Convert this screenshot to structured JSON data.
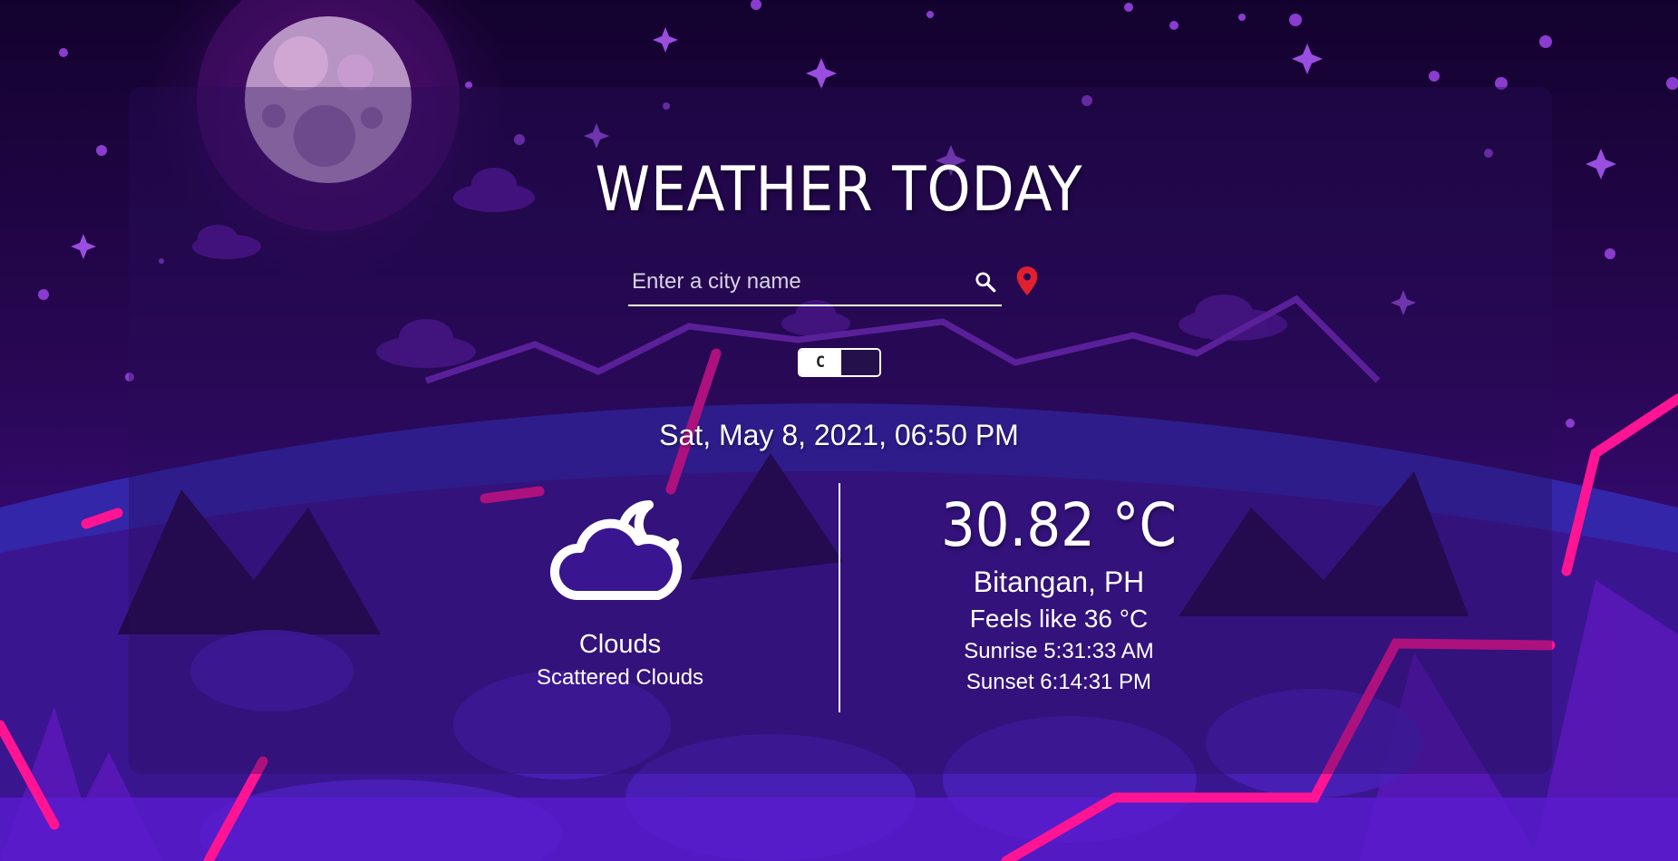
{
  "header": {
    "title": "WEATHER TODAY"
  },
  "search": {
    "placeholder": "Enter a city name",
    "value": "",
    "search_icon": "search-icon",
    "location_icon": "map-pin-icon"
  },
  "unit_toggle": {
    "label": "C"
  },
  "datetime": "Sat, May 8, 2021, 06:50 PM",
  "weather": {
    "icon": "cloud-moon-icon",
    "main": "Clouds",
    "description": "Scattered Clouds"
  },
  "details": {
    "temperature": "30.82 °C",
    "location": "Bitangan, PH",
    "feels_like": "Feels like 36 °C",
    "sunrise": "Sunrise 5:31:33 AM",
    "sunset": "Sunset 6:14:31 PM"
  },
  "colors": {
    "pin": "#e0202e",
    "accent_pink": "#ff1493",
    "sky": "#1a0536"
  }
}
